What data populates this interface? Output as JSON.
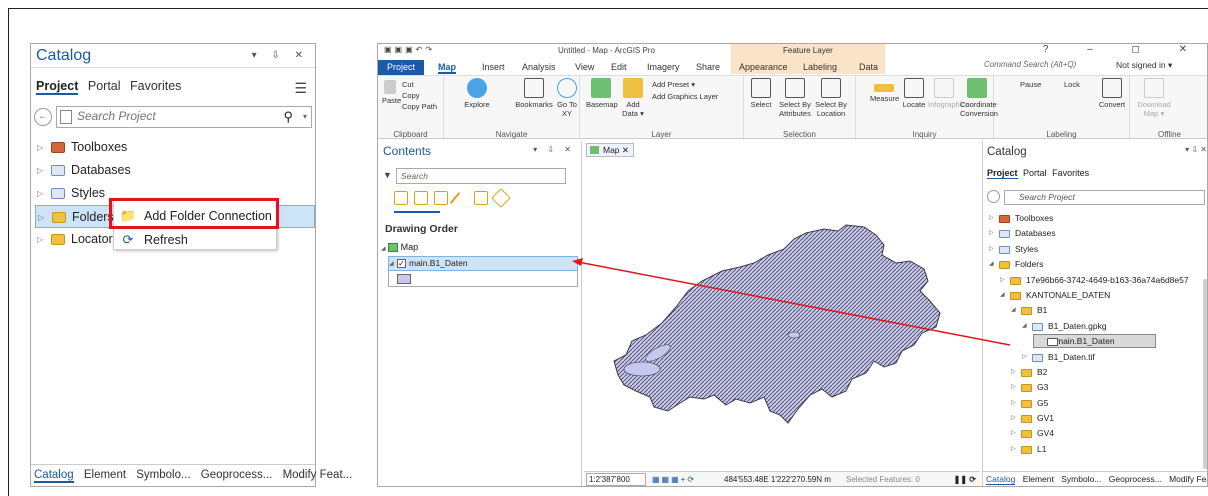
{
  "left_catalog": {
    "title": "Catalog",
    "window_buttons": "▾ ⇩ ✕",
    "tabs": [
      "Project",
      "Portal",
      "Favorites"
    ],
    "search_placeholder": "Search Project",
    "tree": [
      {
        "label": "Toolboxes",
        "icon": "toolbox-icon"
      },
      {
        "label": "Databases",
        "icon": "database-icon"
      },
      {
        "label": "Styles",
        "icon": "styles-icon"
      },
      {
        "label": "Folders",
        "icon": "folder-icon"
      },
      {
        "label": "Locators",
        "icon": "locator-icon"
      }
    ],
    "context_menu": [
      {
        "label": "Add Folder Connection",
        "icon": "add-folder-icon"
      },
      {
        "label": "Refresh",
        "icon": "refresh-icon"
      }
    ],
    "bottom_tabs": [
      "Catalog",
      "Element",
      "Symbolo...",
      "Geoprocess...",
      "Modify Feat..."
    ],
    "highlight_color": "#e0141c"
  },
  "app": {
    "title": "Untitled - Map - ArcGIS Pro",
    "context_tab_title": "Feature Layer",
    "window_controls": "?  –  ◻  ✕",
    "ribbon_tabs": [
      "Project",
      "Map",
      "Insert",
      "Analysis",
      "View",
      "Edit",
      "Imagery",
      "Share",
      "Appearance",
      "Labeling",
      "Data"
    ],
    "command_search": "Command Search (Alt+Q)",
    "sign_in": "Not signed in ▾",
    "ribbon": {
      "clipboard": {
        "label": "Clipboard",
        "paste": "Paste",
        "cut": "Cut",
        "copy": "Copy",
        "copy_path": "Copy Path"
      },
      "navigate": {
        "label": "Navigate",
        "explore": "Explore",
        "bookmarks": "Bookmarks",
        "goto": "Go To XY"
      },
      "layer": {
        "label": "Layer",
        "basemap": "Basemap",
        "add_data": "Add Data ▾",
        "add_preset": "Add Preset ▾",
        "add_graphics": "Add Graphics Layer"
      },
      "selection": {
        "label": "Selection",
        "select": "Select",
        "by_attr": "Select By Attributes",
        "by_loc": "Select By Location"
      },
      "inquiry": {
        "label": "Inquiry",
        "measure": "Measure",
        "locate": "Locate",
        "infographics": "Infographics",
        "coord": "Coordinate Conversion"
      },
      "labeling": {
        "label": "Labeling",
        "pause": "Pause",
        "lock": "Lock",
        "convert": "Convert"
      },
      "offline": {
        "label": "Offline",
        "download": "Download Map ▾"
      }
    }
  },
  "contents": {
    "title": "Contents",
    "window_buttons": "▾ ⇩ ✕",
    "search_placeholder": "Search",
    "drawing_order": "Drawing Order",
    "map_label": "Map",
    "layer_label": "main.B1_Daten",
    "swatch_color": "#c7c7ef"
  },
  "mapview": {
    "tab_label": "Map",
    "scale": "1:2'387'800",
    "coordinates": "484'553.48E 1'222'270.59N m",
    "selected": "Selected Features: 0"
  },
  "right_catalog": {
    "title": "Catalog",
    "tabs": [
      "Project",
      "Portal",
      "Favorites"
    ],
    "search_placeholder": "Search Project",
    "tree": [
      {
        "label": "Toolboxes",
        "level": 0,
        "arrow": "▷",
        "kind": "tool"
      },
      {
        "label": "Databases",
        "level": 0,
        "arrow": "▷",
        "kind": "db"
      },
      {
        "label": "Styles",
        "level": 0,
        "arrow": "▷",
        "kind": "db"
      },
      {
        "label": "Folders",
        "level": 0,
        "arrow": "◢",
        "kind": "fold"
      },
      {
        "label": "17e96b66-3742-4649-b163-36a74a6d8e57",
        "level": 1,
        "arrow": "▷",
        "kind": "fold"
      },
      {
        "label": "KANTONALE_DATEN",
        "level": 1,
        "arrow": "◢",
        "kind": "fold"
      },
      {
        "label": "B1",
        "level": 2,
        "arrow": "◢",
        "kind": "fold"
      },
      {
        "label": "B1_Daten.gpkg",
        "level": 3,
        "arrow": "◢",
        "kind": "db"
      },
      {
        "label": "main.B1_Daten",
        "level": 4,
        "arrow": "",
        "kind": "sel"
      },
      {
        "label": "B1_Daten.tif",
        "level": 3,
        "arrow": "▷",
        "kind": "db"
      },
      {
        "label": "B2",
        "level": 2,
        "arrow": "▷",
        "kind": "fold"
      },
      {
        "label": "G3",
        "level": 2,
        "arrow": "▷",
        "kind": "fold"
      },
      {
        "label": "G5",
        "level": 2,
        "arrow": "▷",
        "kind": "fold"
      },
      {
        "label": "GV1",
        "level": 2,
        "arrow": "▷",
        "kind": "fold"
      },
      {
        "label": "GV4",
        "level": 2,
        "arrow": "▷",
        "kind": "fold"
      },
      {
        "label": "L1",
        "level": 2,
        "arrow": "▷",
        "kind": "fold"
      }
    ],
    "bottom_tabs": [
      "Catalog",
      "Element",
      "Symbolo...",
      "Geoprocess...",
      "Modify Feat..."
    ]
  },
  "annotation": {
    "arrow_color": "#e0141c"
  }
}
